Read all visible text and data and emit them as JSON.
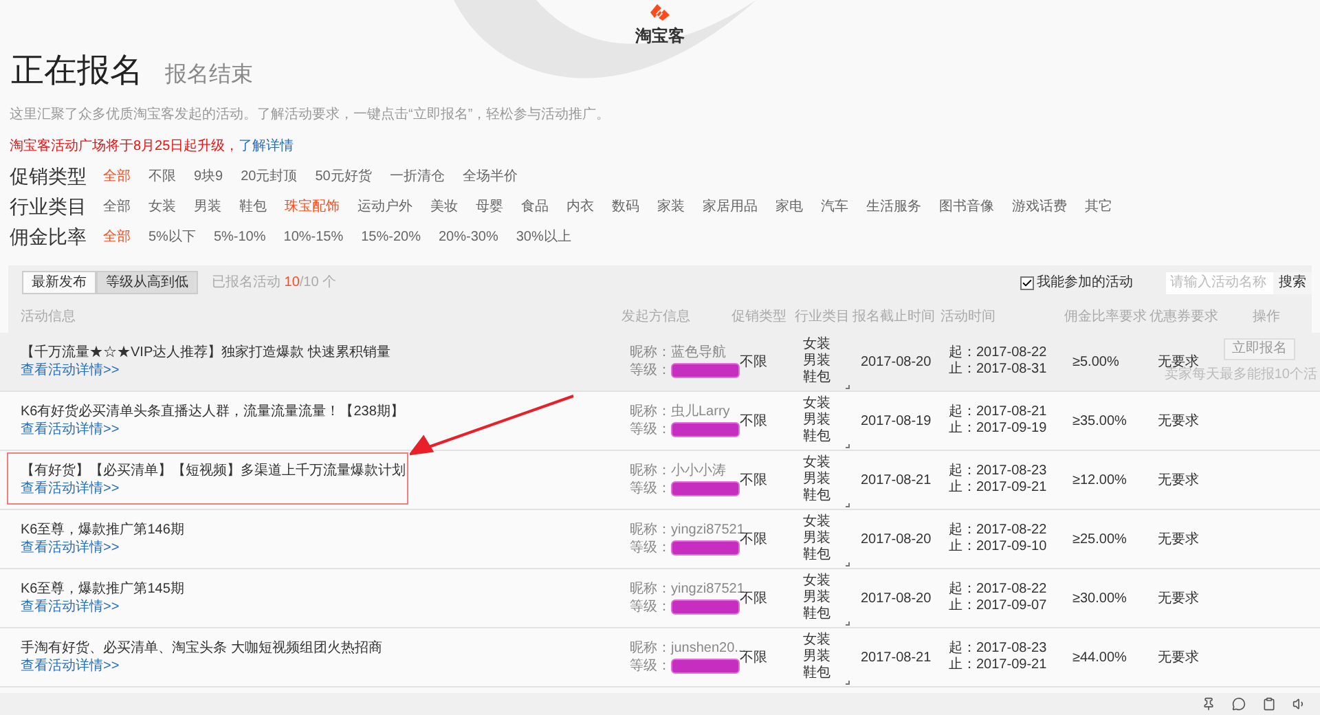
{
  "logo": {
    "text": "淘宝客"
  },
  "tabs": [
    {
      "label": "正在报名",
      "selected": true
    },
    {
      "label": "报名结束",
      "selected": false
    }
  ],
  "description": "这里汇聚了众多优质淘宝客发起的活动。了解活动要求，一键点击“立即报名”，轻松参与活动推广。",
  "notice": {
    "text": "淘宝客活动广场将于8月25日起升级，",
    "link": "了解详情"
  },
  "filters": [
    {
      "label": "促销类型",
      "options": [
        {
          "label": "全部",
          "selected": true
        },
        {
          "label": "不限",
          "selected": false
        },
        {
          "label": "9块9",
          "selected": false
        },
        {
          "label": "20元封顶",
          "selected": false
        },
        {
          "label": "50元好货",
          "selected": false
        },
        {
          "label": "一折清仓",
          "selected": false
        },
        {
          "label": "全场半价",
          "selected": false
        }
      ]
    },
    {
      "label": "行业类目",
      "options": [
        {
          "label": "全部",
          "selected": false
        },
        {
          "label": "女装",
          "selected": false
        },
        {
          "label": "男装",
          "selected": false
        },
        {
          "label": "鞋包",
          "selected": false
        },
        {
          "label": "珠宝配饰",
          "selected": true
        },
        {
          "label": "运动户外",
          "selected": false
        },
        {
          "label": "美妆",
          "selected": false
        },
        {
          "label": "母婴",
          "selected": false
        },
        {
          "label": "食品",
          "selected": false
        },
        {
          "label": "内衣",
          "selected": false
        },
        {
          "label": "数码",
          "selected": false
        },
        {
          "label": "家装",
          "selected": false
        },
        {
          "label": "家居用品",
          "selected": false
        },
        {
          "label": "家电",
          "selected": false
        },
        {
          "label": "汽车",
          "selected": false
        },
        {
          "label": "生活服务",
          "selected": false
        },
        {
          "label": "图书音像",
          "selected": false
        },
        {
          "label": "游戏话费",
          "selected": false
        },
        {
          "label": "其它",
          "selected": false
        }
      ]
    },
    {
      "label": "佣金比率",
      "options": [
        {
          "label": "全部",
          "selected": true
        },
        {
          "label": "5%以下",
          "selected": false
        },
        {
          "label": "5%-10%",
          "selected": false
        },
        {
          "label": "10%-15%",
          "selected": false
        },
        {
          "label": "15%-20%",
          "selected": false
        },
        {
          "label": "20%-30%",
          "selected": false
        },
        {
          "label": "30%以上",
          "selected": false
        }
      ]
    }
  ],
  "sort_buttons": [
    {
      "label": "最新发布",
      "selected": false
    },
    {
      "label": "等级从高到低",
      "selected": true
    }
  ],
  "enrolled": {
    "label": "已报名活动",
    "count": "10",
    "total": "/10 个"
  },
  "only_eligible": {
    "label": "我能参加的活动",
    "checked": true
  },
  "search": {
    "placeholder": "请输入活动名称",
    "button": "搜索"
  },
  "table": {
    "columns": [
      "活动信息",
      "发起方信息",
      "促销类型",
      "行业类目",
      "报名截止时间",
      "活动时间",
      "佣金比率要求",
      "优惠券要求",
      "操作"
    ],
    "rows": [
      {
        "title": "【千万流量★☆★VIP达人推荐】独家打造爆款 快速累积销量",
        "link": "查看活动详情>>",
        "nickname": "昵称：蓝色导航",
        "level": "等级：",
        "promo": "不限",
        "categories": [
          "女装",
          "男装",
          "鞋包"
        ],
        "deadline": "2017-08-20",
        "start": "起：2017-08-22",
        "end": "止：2017-08-31",
        "commission": "≥5.00%",
        "coupon": "无要求",
        "hover": true,
        "highlighted": false,
        "action": {
          "label": "立即报名",
          "disabled": true,
          "note": "卖家每天最多能报10个活"
        }
      },
      {
        "title": "K6有好货必买清单头条直播达人群，流量流量流量！【238期】",
        "link": "查看活动详情>>",
        "nickname": "昵称：虫儿Larry",
        "level": "等级：",
        "promo": "不限",
        "categories": [
          "女装",
          "男装",
          "鞋包"
        ],
        "deadline": "2017-08-19",
        "start": "起：2017-08-21",
        "end": "止：2017-09-19",
        "commission": "≥35.00%",
        "coupon": "无要求",
        "hover": false,
        "highlighted": false
      },
      {
        "title": "【有好货】【必买清单】【短视频】多渠道上千万流量爆款计划",
        "link": "查看活动详情>>",
        "nickname": "昵称：小小小涛",
        "level": "等级：",
        "promo": "不限",
        "categories": [
          "女装",
          "男装",
          "鞋包"
        ],
        "deadline": "2017-08-21",
        "start": "起：2017-08-23",
        "end": "止：2017-09-21",
        "commission": "≥12.00%",
        "coupon": "无要求",
        "hover": false,
        "highlighted": true
      },
      {
        "title": "K6至尊，爆款推广第146期",
        "link": "查看活动详情>>",
        "nickname": "昵称：yingzi87521",
        "level": "等级：",
        "promo": "不限",
        "categories": [
          "女装",
          "男装",
          "鞋包"
        ],
        "deadline": "2017-08-20",
        "start": "起：2017-08-22",
        "end": "止：2017-09-10",
        "commission": "≥25.00%",
        "coupon": "无要求",
        "hover": false,
        "highlighted": false
      },
      {
        "title": "K6至尊，爆款推广第145期",
        "link": "查看活动详情>>",
        "nickname": "昵称：yingzi87521",
        "level": "等级：",
        "promo": "不限",
        "categories": [
          "女装",
          "男装",
          "鞋包"
        ],
        "deadline": "2017-08-20",
        "start": "起：2017-08-22",
        "end": "止：2017-09-07",
        "commission": "≥30.00%",
        "coupon": "无要求",
        "hover": false,
        "highlighted": false
      },
      {
        "title": "手淘有好货、必买清单、淘宝头条 大咖短视频组团火热招商",
        "link": "查看活动详情>>",
        "nickname": "昵称：junshen20...",
        "level": "等级：",
        "promo": "不限",
        "categories": [
          "女装",
          "男装",
          "鞋包"
        ],
        "deadline": "2017-08-21",
        "start": "起：2017-08-23",
        "end": "止：2017-09-21",
        "commission": "≥44.00%",
        "coupon": "无要求",
        "hover": false,
        "highlighted": false
      }
    ]
  }
}
